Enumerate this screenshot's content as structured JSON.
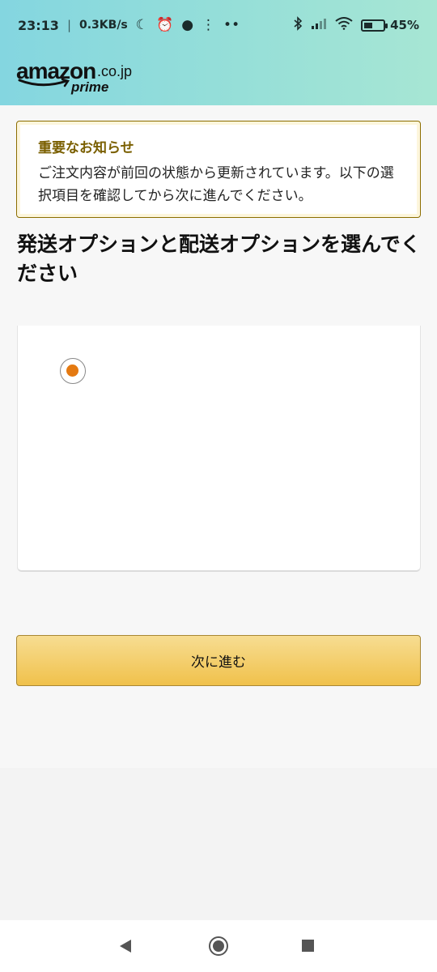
{
  "status_bar": {
    "time": "23:13",
    "separator": "|",
    "network_speed": "0.3KB/s",
    "battery_percent": "45%",
    "battery_level": 0.45,
    "icons": [
      "moon-icon",
      "alarm-icon",
      "drop-icon",
      "footsteps-icon",
      "more-dots-icon",
      "bluetooth-icon",
      "signal-icon",
      "wifi-icon",
      "battery-icon"
    ]
  },
  "header": {
    "logo_main": "amazon",
    "logo_tld": ".co.jp",
    "logo_sub": "prime"
  },
  "alert": {
    "title": "重要なお知らせ",
    "message": "ご注文内容が前回の状態から更新されています。以下の選択項目を確認してから次に進んでください。"
  },
  "page": {
    "heading": "発送オプションと配送オプションを選んでください"
  },
  "shipping_option": {
    "selected": true
  },
  "actions": {
    "next_label": "次に進む"
  },
  "colors": {
    "accent_orange": "#e47911",
    "button_yellow": "#f0c14b",
    "alert_title": "#7a5f00",
    "header_teal": "#84d6e0"
  }
}
